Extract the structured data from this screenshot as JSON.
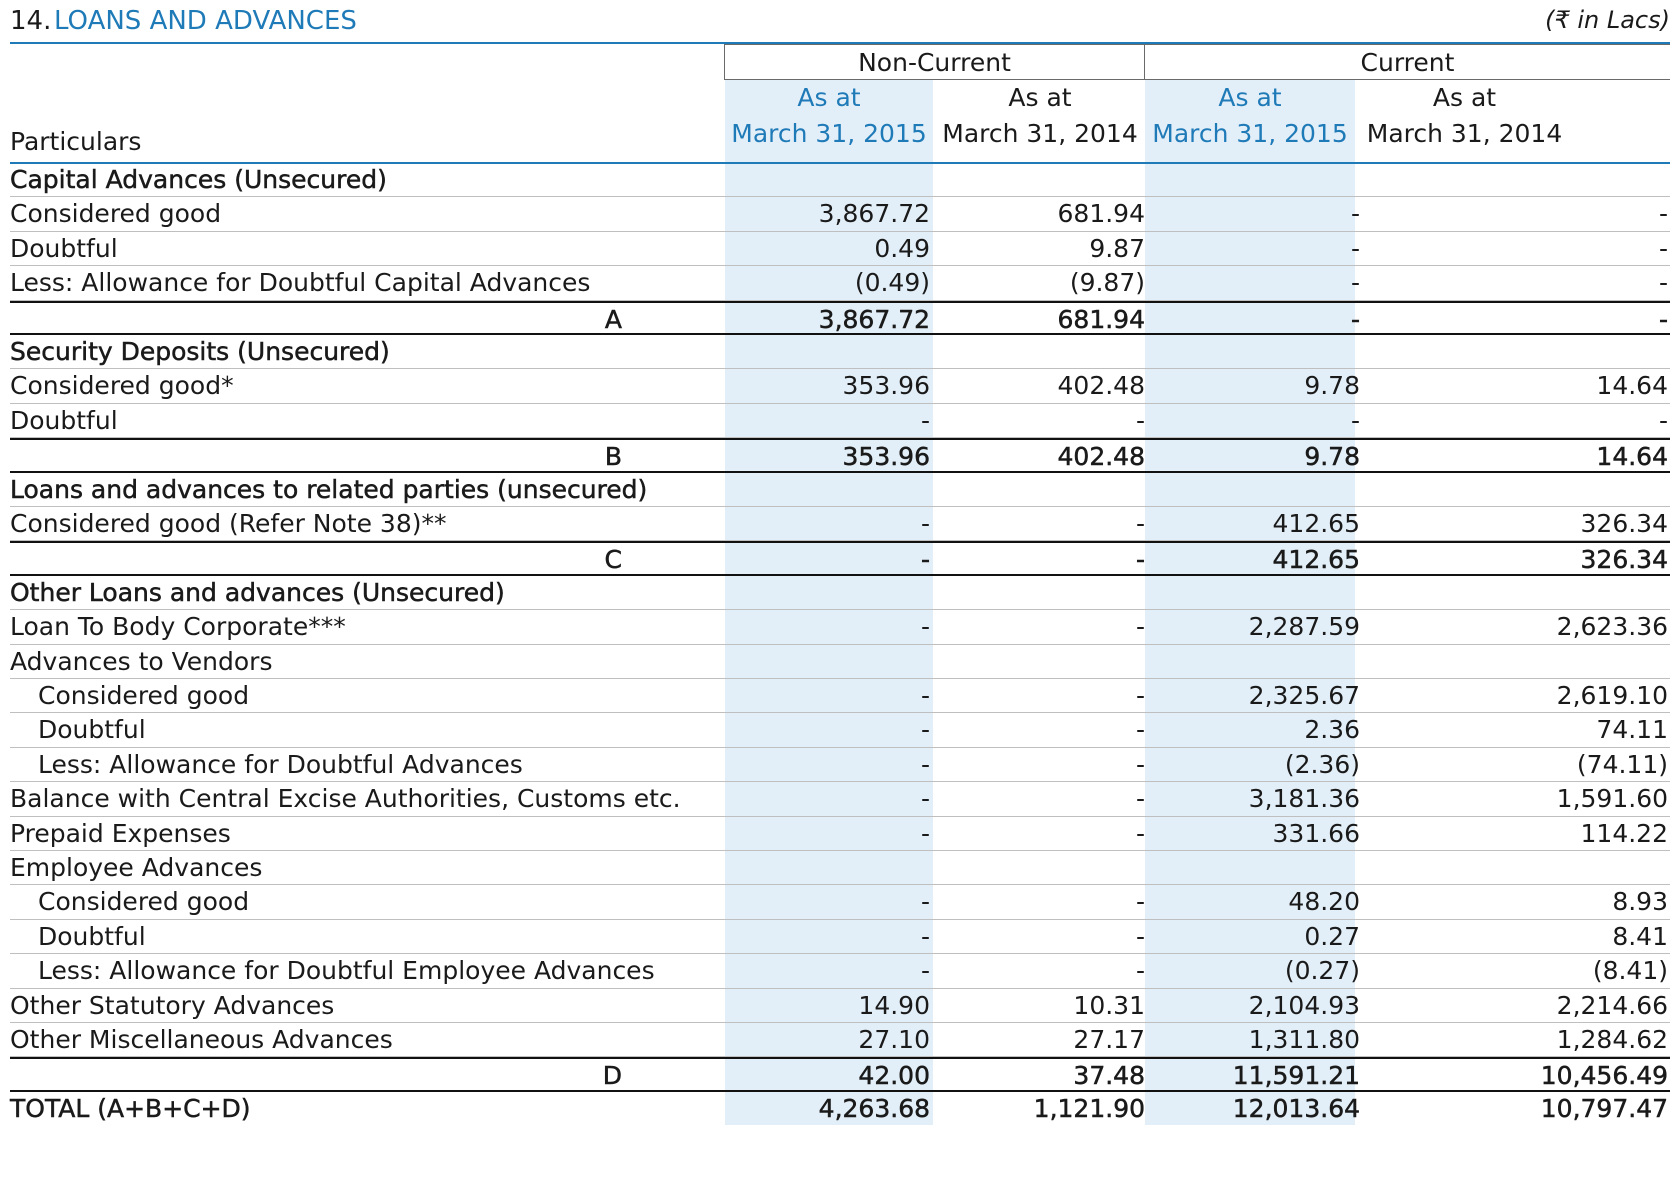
{
  "header": {
    "note_number": "14.",
    "title": "LOANS AND ADVANCES",
    "unit": "(₹ in Lacs)"
  },
  "columns": {
    "groups": [
      "Non-Current",
      "Current"
    ],
    "particulars_label": "Particulars",
    "col1": {
      "line1": "As at",
      "line2": "March 31, 2015"
    },
    "col2": {
      "line1": "As at",
      "line2": "March 31, 2014"
    },
    "col3": {
      "line1": "As at",
      "line2": "March 31, 2015"
    },
    "col4": {
      "line1": "As at",
      "line2": "March 31, 2014"
    }
  },
  "colors": {
    "accent": "#1f7ab8",
    "shade": "#e3eff8"
  },
  "rows": [
    {
      "type": "heading",
      "label": "Capital Advances (Unsecured)",
      "values": [
        "",
        "",
        "",
        ""
      ]
    },
    {
      "type": "item",
      "label": "Considered good",
      "values": [
        "3,867.72",
        "681.94",
        "-",
        "-"
      ]
    },
    {
      "type": "item",
      "label": "Doubtful",
      "values": [
        "0.49",
        "9.87",
        "-",
        "-"
      ]
    },
    {
      "type": "item",
      "label": "Less: Allowance for Doubtful Capital Advances",
      "values": [
        "(0.49)",
        "(9.87)",
        "-",
        "-"
      ]
    },
    {
      "type": "sub",
      "label": "A",
      "values": [
        "3,867.72",
        "681.94",
        "-",
        "-"
      ]
    },
    {
      "type": "heading",
      "label": "Security Deposits (Unsecured)",
      "values": [
        "",
        "",
        "",
        ""
      ]
    },
    {
      "type": "item",
      "label": "Considered good*",
      "values": [
        "353.96",
        "402.48",
        "9.78",
        "14.64"
      ]
    },
    {
      "type": "item",
      "label": "Doubtful",
      "values": [
        "-",
        "-",
        "-",
        "-"
      ]
    },
    {
      "type": "sub",
      "label": "B",
      "values": [
        "353.96",
        "402.48",
        "9.78",
        "14.64"
      ]
    },
    {
      "type": "heading",
      "label": "Loans and advances to related parties (unsecured)",
      "values": [
        "",
        "",
        "",
        ""
      ]
    },
    {
      "type": "item",
      "label": "Considered good (Refer Note 38)**",
      "values": [
        "-",
        "-",
        "412.65",
        "326.34"
      ]
    },
    {
      "type": "sub",
      "label": "C",
      "values": [
        "-",
        "-",
        "412.65",
        "326.34"
      ]
    },
    {
      "type": "heading",
      "label": "Other Loans and advances (Unsecured)",
      "values": [
        "",
        "",
        "",
        ""
      ]
    },
    {
      "type": "item",
      "label": "Loan To Body Corporate***",
      "values": [
        "-",
        "-",
        "2,287.59",
        "2,623.36"
      ]
    },
    {
      "type": "item",
      "label": "Advances to Vendors",
      "values": [
        "",
        "",
        "",
        ""
      ]
    },
    {
      "type": "indent",
      "label": "Considered good",
      "values": [
        "-",
        "-",
        "2,325.67",
        "2,619.10"
      ]
    },
    {
      "type": "indent",
      "label": "Doubtful",
      "values": [
        "-",
        "-",
        "2.36",
        "74.11"
      ]
    },
    {
      "type": "indent",
      "label": "Less: Allowance for Doubtful Advances",
      "values": [
        "-",
        "-",
        "(2.36)",
        "(74.11)"
      ]
    },
    {
      "type": "item",
      "label": "Balance with Central Excise Authorities, Customs etc.",
      "values": [
        "-",
        "-",
        "3,181.36",
        "1,591.60"
      ]
    },
    {
      "type": "item",
      "label": "Prepaid Expenses",
      "values": [
        "-",
        "-",
        "331.66",
        "114.22"
      ]
    },
    {
      "type": "item",
      "label": "Employee Advances",
      "values": [
        "",
        "",
        "",
        ""
      ]
    },
    {
      "type": "indent",
      "label": "Considered good",
      "values": [
        "-",
        "-",
        "48.20",
        "8.93"
      ]
    },
    {
      "type": "indent",
      "label": "Doubtful",
      "values": [
        "-",
        "-",
        "0.27",
        "8.41"
      ]
    },
    {
      "type": "indent",
      "label": "Less: Allowance for Doubtful Employee Advances",
      "values": [
        "-",
        "-",
        "(0.27)",
        "(8.41)"
      ]
    },
    {
      "type": "item",
      "label": "Other Statutory Advances",
      "values": [
        "14.90",
        "10.31",
        "2,104.93",
        "2,214.66"
      ]
    },
    {
      "type": "item",
      "label": "Other Miscellaneous Advances",
      "values": [
        "27.10",
        "27.17",
        "1,311.80",
        "1,284.62"
      ]
    },
    {
      "type": "sub",
      "label": "D",
      "values": [
        "42.00",
        "37.48",
        "11,591.21",
        "10,456.49"
      ]
    },
    {
      "type": "total",
      "label": "TOTAL (A+B+C+D)",
      "values": [
        "4,263.68",
        "1,121.90",
        "12,013.64",
        "10,797.47"
      ]
    }
  ]
}
